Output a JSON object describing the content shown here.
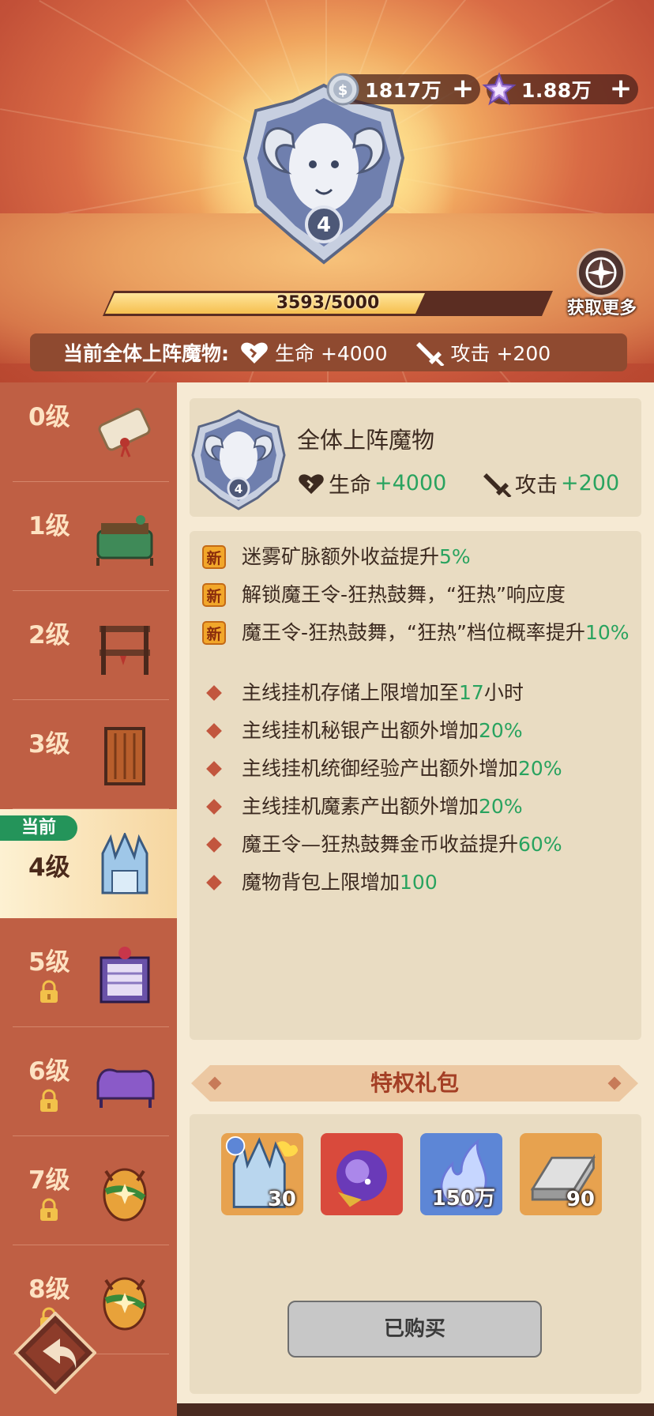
{
  "currency": {
    "silver": {
      "icon": "silver-coin-icon",
      "value": "1817万"
    },
    "gem": {
      "icon": "star-gem-icon",
      "value": "1.88万"
    }
  },
  "emblem": {
    "icon": "ram-emblem-icon",
    "level": "4"
  },
  "progress": {
    "text": "3593/5000",
    "current": 3593,
    "max": 5000
  },
  "more_button": {
    "label": "获取更多",
    "icon": "compass-icon"
  },
  "bonus_bar": {
    "label": "当前全体上阵魔物:",
    "hp": {
      "icon": "heart-icon",
      "text": "生命 +4000"
    },
    "atk": {
      "icon": "sword-icon",
      "text": "攻击 +200"
    }
  },
  "sidebar": {
    "current_badge": "当前",
    "levels": [
      {
        "label": "0级",
        "item": "scroll-icon",
        "locked": false,
        "current": false
      },
      {
        "label": "1级",
        "item": "green-bed-icon",
        "locked": false,
        "current": false
      },
      {
        "label": "2级",
        "item": "shelf-icon",
        "locked": false,
        "current": false
      },
      {
        "label": "3级",
        "item": "wooden-door-icon",
        "locked": false,
        "current": false
      },
      {
        "label": "4级",
        "item": "ice-throne-icon",
        "locked": false,
        "current": true
      },
      {
        "label": "5级",
        "item": "purple-cabinet-icon",
        "locked": true,
        "current": false
      },
      {
        "label": "6级",
        "item": "purple-sofa-icon",
        "locked": true,
        "current": false
      },
      {
        "label": "7级",
        "item": "monster-egg-icon",
        "locked": true,
        "current": false
      },
      {
        "label": "8级",
        "item": "monster-egg-icon",
        "locked": true,
        "current": false
      }
    ]
  },
  "info_card": {
    "title": "全体上阵魔物",
    "hp_label": "生命",
    "hp_value": "+4000",
    "atk_label": "攻击",
    "atk_value": "+200"
  },
  "perks": [
    {
      "tag": "新",
      "text": "迷雾矿脉额外收益提升",
      "hl": "5%",
      "suffix": ""
    },
    {
      "tag": "新",
      "text": "解锁魔王令-狂热鼓舞，“狂热”响应度",
      "hl": "",
      "suffix": ""
    },
    {
      "tag": "新",
      "text": "魔王令-狂热鼓舞，“狂热”档位概率提升",
      "hl": "10%",
      "suffix": ""
    },
    {
      "tag": "",
      "text": "主线挂机存储上限增加至",
      "hl": "17",
      "suffix": "小时"
    },
    {
      "tag": "",
      "text": "主线挂机秘银产出额外增加",
      "hl": "20%",
      "suffix": ""
    },
    {
      "tag": "",
      "text": "主线挂机统御经验产出额外增加",
      "hl": "20%",
      "suffix": ""
    },
    {
      "tag": "",
      "text": "主线挂机魔素产出额外增加",
      "hl": "20%",
      "suffix": ""
    },
    {
      "tag": "",
      "text": "魔王令—狂热鼓舞金币收益提升",
      "hl": "60%",
      "suffix": ""
    },
    {
      "tag": "",
      "text": "魔物背包上限增加",
      "hl": "100",
      "suffix": ""
    }
  ],
  "gift_header": "特权礼包",
  "gifts": [
    {
      "icon": "ice-throne-icon",
      "qty": "30",
      "frame": "#e7a24f"
    },
    {
      "icon": "cosmic-orb-icon",
      "qty": "",
      "frame": "#d94a3c"
    },
    {
      "icon": "blue-flame-icon",
      "qty": "150万",
      "frame": "#5d86d6"
    },
    {
      "icon": "silver-ingot-icon",
      "qty": "90",
      "frame": "#e7a24f"
    }
  ],
  "buy_button": "已购买",
  "colors": {
    "highlight": "#29a35f",
    "current_badge": "#24945a",
    "sidebar": "#bf5f44",
    "panel": "#e9dcc2"
  }
}
